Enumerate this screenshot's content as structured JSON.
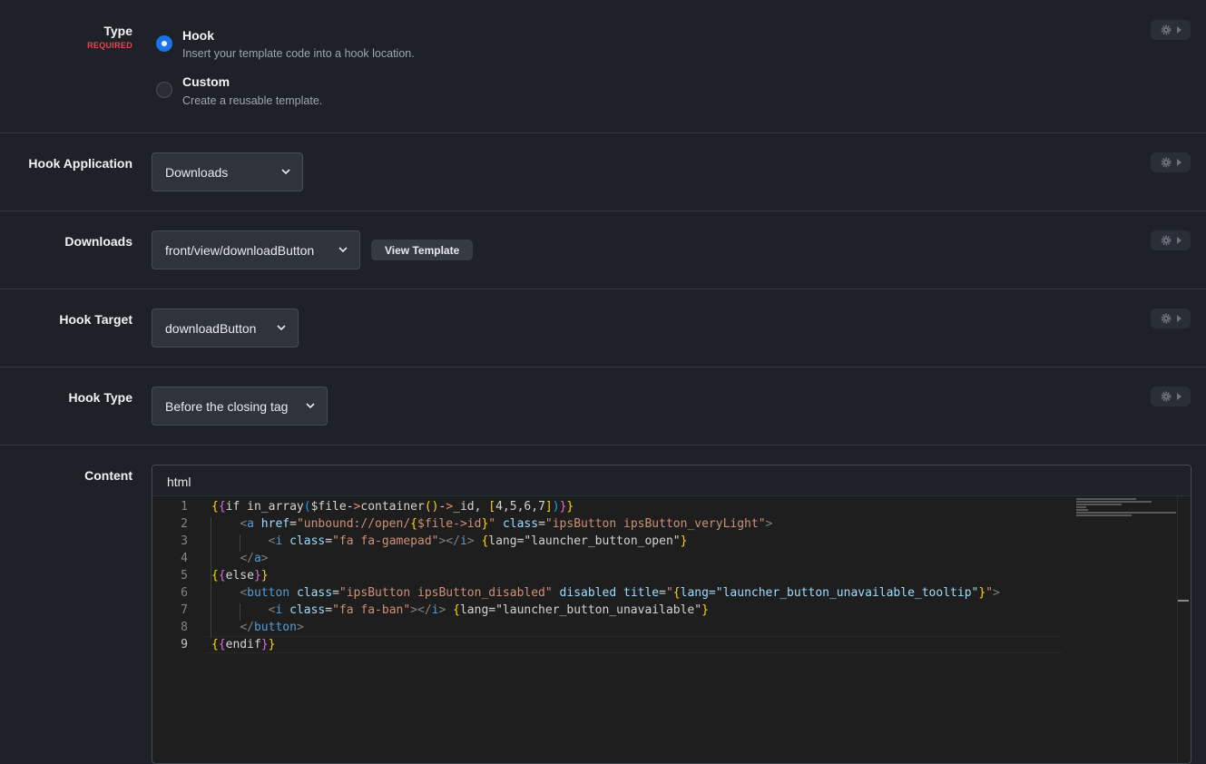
{
  "type": {
    "label": "Type",
    "required": "REQUIRED",
    "options": [
      {
        "title": "Hook",
        "desc": "Insert your template code into a hook location.",
        "selected": true
      },
      {
        "title": "Custom",
        "desc": "Create a reusable template.",
        "selected": false
      }
    ]
  },
  "hook_application": {
    "label": "Hook Application",
    "value": "Downloads"
  },
  "downloads": {
    "label": "Downloads",
    "value": "front/view/downloadButton",
    "view_template": "View Template"
  },
  "hook_target": {
    "label": "Hook Target",
    "value": "downloadButton"
  },
  "hook_type": {
    "label": "Hook Type",
    "value": "Before the closing tag"
  },
  "content": {
    "label": "Content",
    "language": "html",
    "line_numbers": [
      "1",
      "2",
      "3",
      "4",
      "5",
      "6",
      "7",
      "8",
      "9"
    ],
    "lines": [
      "{{if in_array($file->container()->_id, [4,5,6,7])}}",
      "    <a href=\"unbound://open/{$file->id}\" class=\"ipsButton ipsButton_veryLight\">",
      "        <i class=\"fa fa-gamepad\"></i> {lang=\"launcher_button_open\"}",
      "    </a>",
      "{{else}}",
      "    <button class=\"ipsButton ipsButton_disabled\" disabled title=\"{lang=\"launcher_button_unavailable_tooltip\"}\">",
      "        <i class=\"fa fa-ban\"></i> {lang=\"launcher_button_unavailable\"}",
      "    </button>",
      "{{endif}}"
    ]
  },
  "colors": {
    "accent": "#1a73e8",
    "required": "#e5484d",
    "background": "#1e2128"
  },
  "icons": [
    "gear-icon",
    "caret-right-icon",
    "chevron-down-icon"
  ]
}
